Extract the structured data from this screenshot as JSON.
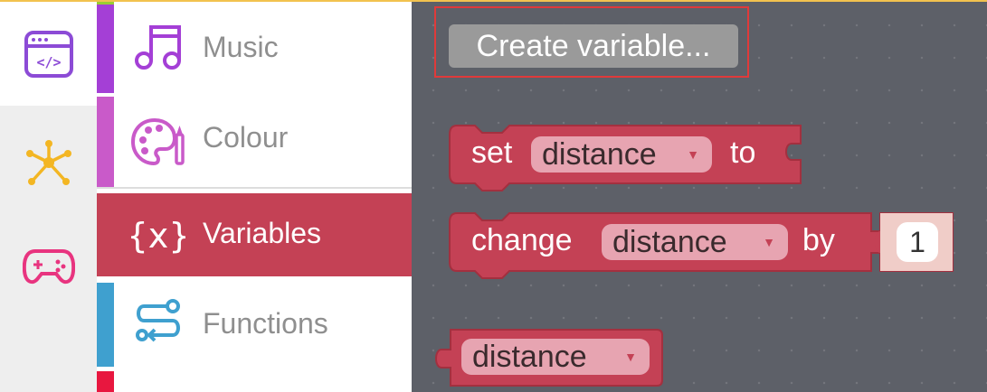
{
  "rail": {
    "items": [
      {
        "icon": "code-window-icon",
        "active": true
      },
      {
        "icon": "network-icon",
        "active": false
      },
      {
        "icon": "gamepad-icon",
        "active": false
      }
    ]
  },
  "categories": [
    {
      "label": "Music",
      "color": "#a43fd6",
      "icon": "music-note-icon"
    },
    {
      "label": "Colour",
      "color": "#c95ac9",
      "icon": "palette-icon"
    },
    {
      "label": "Variables",
      "color": "#c44155",
      "icon": "braces-x-icon",
      "selected": true
    },
    {
      "label": "Functions",
      "color": "#3fa0cf",
      "icon": "functions-icon"
    }
  ],
  "workspace": {
    "create_variable_label": "Create variable...",
    "blocks": {
      "set": {
        "keyword": "set",
        "variable": "distance",
        "connector": "to"
      },
      "change": {
        "keyword": "change",
        "variable": "distance",
        "connector": "by",
        "value": "1"
      },
      "getter": {
        "variable": "distance"
      }
    },
    "block_color": "#c44155",
    "field_color": "#e7a4b1"
  }
}
